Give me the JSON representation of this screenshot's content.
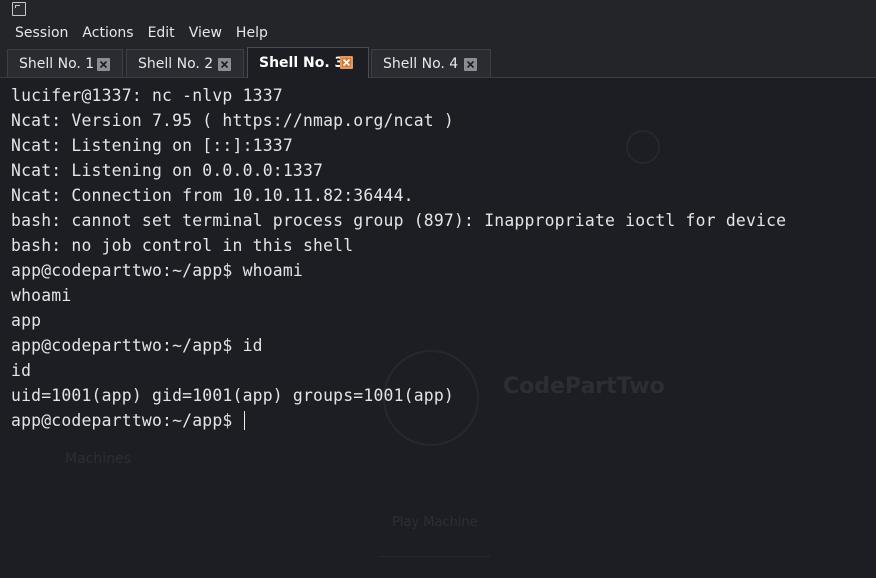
{
  "menubar": {
    "items": [
      "Session",
      "Actions",
      "Edit",
      "View",
      "Help"
    ]
  },
  "tabs": [
    {
      "label": "Shell No. 1",
      "active": false
    },
    {
      "label": "Shell No. 2",
      "active": false
    },
    {
      "label": "Shell No. 3",
      "active": true
    },
    {
      "label": "Shell No. 4",
      "active": false
    }
  ],
  "terminal": {
    "lines": [
      "lucifer@1337: nc -nlvp 1337",
      "Ncat: Version 7.95 ( https://nmap.org/ncat )",
      "Ncat: Listening on [::]:1337",
      "Ncat: Listening on 0.0.0.0:1337",
      "Ncat: Connection from 10.10.11.82:36444.",
      "bash: cannot set terminal process group (897): Inappropriate ioctl for device",
      "bash: no job control in this shell",
      "app@codeparttwo:~/app$ whoami",
      "whoami",
      "app",
      "app@codeparttwo:~/app$ id",
      "id",
      "uid=1001(app) gid=1001(app) groups=1001(app)",
      "app@codeparttwo:~/app$ "
    ]
  },
  "background_ghost": {
    "title": "CodePartTwo",
    "machines": "Machines",
    "play": "Play Machine"
  },
  "colors": {
    "background": "#1c1e23",
    "text": "#e4e4e4",
    "active_close": "#d77a36",
    "inactive_close": "#8a8d92"
  },
  "icons": {
    "app": "terminal-icon",
    "tab_close": "close-icon"
  }
}
